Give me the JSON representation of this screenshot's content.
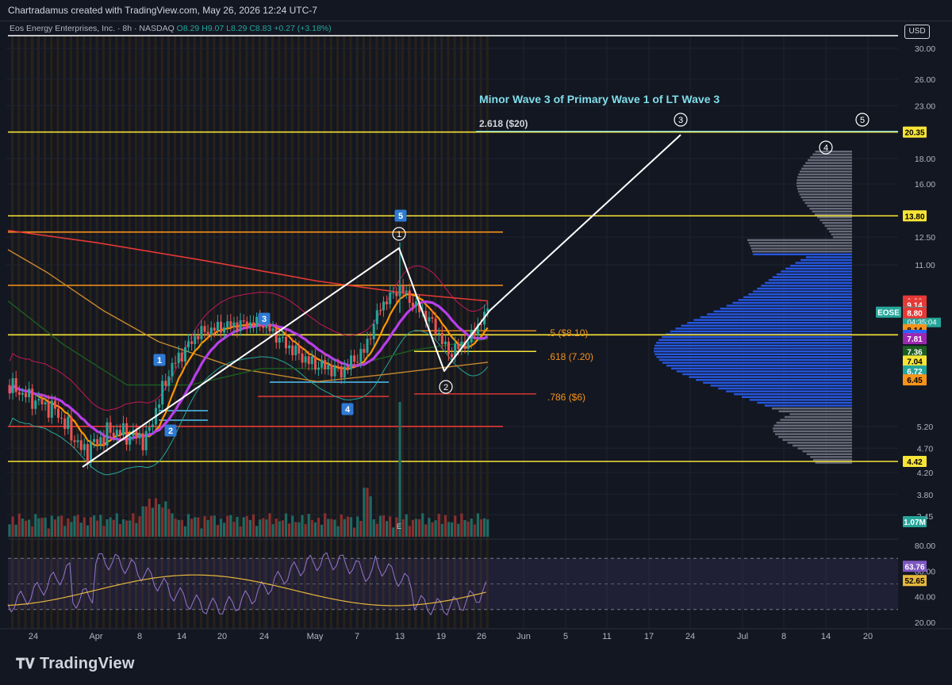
{
  "header": {
    "credit": "Chartradamus created with TradingView.com, May 26, 2026 12:24 UTC-7"
  },
  "legend": {
    "symbol": "Eos Energy Enterprises, Inc. · 8h · NASDAQ",
    "ohlc": "O8.29 H9.07 L8.29 C8.83 +0.27 (+3.18%)"
  },
  "currency": "USD",
  "footer": {
    "brand": "TradingView"
  },
  "colors": {
    "background": "#131722",
    "up": "#26a69a",
    "down": "#ef5350",
    "yellow_level": "#f7e436",
    "orange_level": "#f7931a",
    "red_level": "#e53935",
    "wave_line": "#ffffff",
    "volume_profile": "#2962ff",
    "ma_purple": "#b83fe8",
    "ma_orange": "#ff9800",
    "rsi_line": "#9575cd",
    "rsi_signal": "#e6b73e"
  },
  "chart_data": {
    "type": "candlestick",
    "symbol": "EOSE",
    "interval": "8h",
    "yscale": "log",
    "ylim": [
      4.0,
      31.0
    ],
    "y_ticks": [
      "30.00",
      "26.00",
      "23.00",
      "18.00",
      "16.00",
      "12.50",
      "11.00",
      "5.20",
      "4.70",
      "4.20",
      "3.80",
      "3.45"
    ],
    "x_ticks": [
      "24",
      "Apr",
      "8",
      "14",
      "20",
      "24",
      "May",
      "7",
      "13",
      "19",
      "26",
      "Jun",
      "5",
      "11",
      "17",
      "24",
      "Jul",
      "8",
      "14",
      "20"
    ],
    "price_labels": [
      {
        "text": "20.35",
        "value": 20.35,
        "bg": "#f7e436",
        "fg": "#000000"
      },
      {
        "text": "13.80",
        "value": 13.8,
        "bg": "#f7e436",
        "fg": "#000000"
      },
      {
        "text": "9.30",
        "value": 9.3,
        "bg": "#e53935",
        "fg": "#ffffff"
      },
      {
        "text": "9.14",
        "value": 9.14,
        "bg": "#e53935",
        "fg": "#ffffff"
      },
      {
        "text": "8.83",
        "value": 8.83,
        "bg": "#26a69a",
        "fg": "#ffffff",
        "extra": "04:35:04",
        "tag": "EOSE"
      },
      {
        "text": "8.80",
        "value": 8.8,
        "bg": "#e53935",
        "fg": "#ffffff"
      },
      {
        "text": "8.14",
        "value": 8.14,
        "bg": "#f7931a",
        "fg": "#000000"
      },
      {
        "text": "7.93",
        "value": 7.93,
        "bg": "#2962ff",
        "fg": "#ffffff"
      },
      {
        "text": "7.81",
        "value": 7.81,
        "bg": "#9c27b0",
        "fg": "#ffffff"
      },
      {
        "text": "7.36",
        "value": 7.36,
        "bg": "#1b5e20",
        "fg": "#ffffff"
      },
      {
        "text": "7.04",
        "value": 7.04,
        "bg": "#f7e436",
        "fg": "#000000"
      },
      {
        "text": "6.72",
        "value": 6.72,
        "bg": "#26a69a",
        "fg": "#ffffff"
      },
      {
        "text": "6.45",
        "value": 6.45,
        "bg": "#f7931a",
        "fg": "#000000"
      },
      {
        "text": "4.42",
        "value": 4.42,
        "bg": "#f7e436",
        "fg": "#000000"
      },
      {
        "text": "1.07M",
        "value": 1.07,
        "bg": "#26a69a",
        "fg": "#ffffff"
      }
    ],
    "horizontal_levels": [
      {
        "value": 20.35,
        "color": "#f7e436"
      },
      {
        "value": 13.8,
        "color": "#f7e436"
      },
      {
        "value": 12.8,
        "color": "#f7931a"
      },
      {
        "value": 10.0,
        "color": "#f7931a"
      },
      {
        "value": 7.95,
        "color": "#f7e436"
      },
      {
        "value": 4.42,
        "color": "#f7e436"
      },
      {
        "value": 5.2,
        "color": "#e53935"
      }
    ],
    "annotations": {
      "title": "Minor Wave 3 of Primary Wave 1 of LT Wave 3",
      "target": "2.618 ($20)",
      "fib_50": ".5 ($8.10)",
      "fib_618": ".618 (7.20)",
      "fib_786": ".786 ($6)",
      "minor_waves": [
        "1",
        "2",
        "3",
        "4",
        "5"
      ],
      "primary_waves": [
        "1",
        "2",
        "3",
        "4",
        "5"
      ]
    },
    "wave_path": [
      {
        "label": "start",
        "value": 4.42
      },
      {
        "label": "1",
        "value": 12.2
      },
      {
        "label": "2",
        "value": 6.9
      },
      {
        "label": "now",
        "value": 8.83
      },
      {
        "label": "3",
        "value": 20.35
      }
    ],
    "rsi": {
      "y_ticks": [
        "80.00",
        "60.00",
        "40.00",
        "20.00"
      ],
      "ylim": [
        15,
        85
      ],
      "value_labels": [
        {
          "text": "63.76",
          "bg": "#7e57c2"
        },
        {
          "text": "52.65",
          "bg": "#e6b73e"
        }
      ],
      "upper_band": 70,
      "lower_band": 30
    },
    "volume_last": "1.07M"
  }
}
